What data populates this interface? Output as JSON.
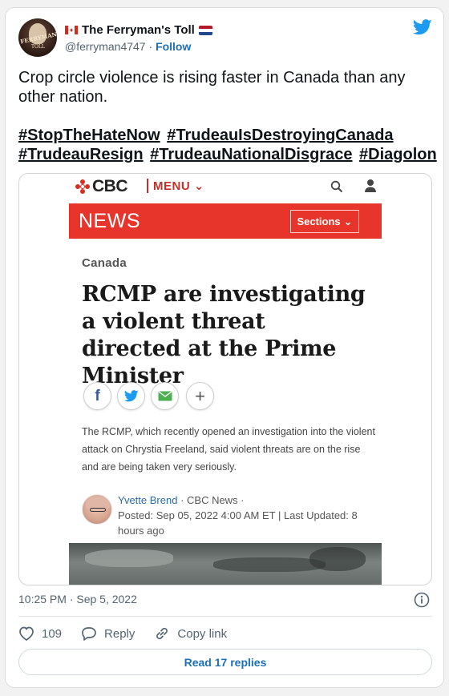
{
  "tweet": {
    "display_name": "The Ferryman's Toll",
    "handle": "@ferryman4747",
    "separator": "·",
    "follow_label": "Follow",
    "text": "Crop circle violence is rising faster in Canada than any other nation.",
    "hashtags": [
      "#StopTheHateNow",
      "#TrudeauIsDestroyingCanada",
      "#TrudeauResign",
      "#TrudeauNationalDisgrace",
      "#Diagolon"
    ],
    "avatar_text": "FERRYMAN'S",
    "avatar_text2": "TOLL",
    "timestamp": "10:25 PM · Sep 5, 2022",
    "likes_count": "109",
    "reply_label": "Reply",
    "copy_link_label": "Copy link",
    "read_replies_label": "Read 17 replies",
    "brand_color": "#1d9bf0"
  },
  "embedded": {
    "logo_text": "CBC",
    "menu_label": "MENU",
    "news_label": "NEWS",
    "sections_label": "Sections",
    "section_name": "Canada",
    "headline": "RCMP are investigating a violent threat directed at the Prime Minister",
    "deck": "The RCMP, which recently opened an investigation into the violent attack on Chrystia Freeland, said violent threats are on the rise and are being taken very seriously.",
    "author": "Yvette Brend",
    "outlet": " · CBC News ·",
    "posted": "Posted: Sep 05, 2022 4:00 AM ET | Last Updated: 8 hours ago",
    "accent_color": "#e7352b"
  }
}
